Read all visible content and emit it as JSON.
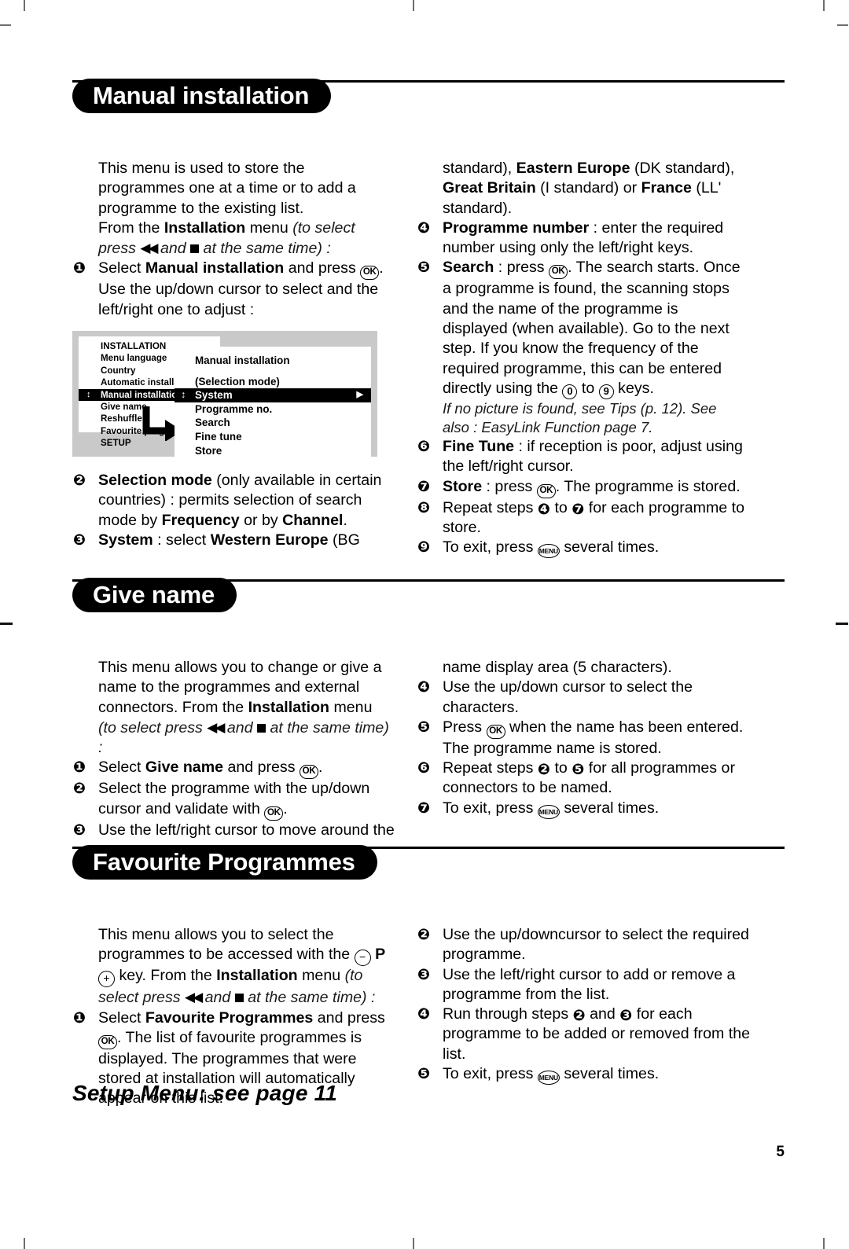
{
  "document": {
    "page_number": "5",
    "setup_note": "Setup Menu: see page 11"
  },
  "sections": [
    {
      "id": "manual-installation",
      "heading": "Manual installation",
      "left": {
        "intro": "This menu is used to store the programmes one at a time or to add a programme to the existing list.",
        "from_menu_prefix": "From the ",
        "from_menu_bold": "Installation",
        "from_menu_mid": " menu ",
        "from_menu_italic_a": "(to select press ",
        "from_menu_italic_b": " and ",
        "from_menu_italic_c": " at the same time) :",
        "step1_a": "Select ",
        "step1_bold": "Manual installation",
        "step1_b": " and press ",
        "step1_c": ". Use the up/down cursor to select and the left/right one to adjust :",
        "step2_bold": "Selection mode",
        "step2_a": " (only available in certain countries) : permits selection of search mode by ",
        "step2_bold2": "Frequency",
        "step2_b": " or by ",
        "step2_bold3": "Channel",
        "step2_c": ".",
        "step3_bold": "System",
        "step3_a": " : select ",
        "step3_bold2": "Western Europe",
        "step3_b": " (BG"
      },
      "figure": {
        "left_menu": {
          "title": "INSTALLATION",
          "items": [
            "Menu language",
            "Country",
            "Automatic installat",
            "Manual installation",
            "Give name",
            "Reshuffle",
            "Favourite program",
            "SETUP"
          ],
          "selected_index": 3
        },
        "right_menu": {
          "title": "Manual installation",
          "items": [
            "(Selection mode)",
            "System",
            "Programme no.",
            "Search",
            "Fine tune",
            "Store"
          ],
          "selected_index": 1
        }
      },
      "right": {
        "cont_a": "standard), ",
        "cont_bold1": "Eastern Europe",
        "cont_b": " (DK standard), ",
        "cont_bold2": "Great Britain",
        "cont_c": " (I standard) or ",
        "cont_bold3": "France",
        "cont_d": " (LL' standard).",
        "step4_bold": "Programme number",
        "step4_a": " : enter the required number using only the left/right keys.",
        "step5_bold": "Search",
        "step5_a": " : press ",
        "step5_b": ". The search starts. Once a programme is found, the scanning stops and the name of the programme is displayed (when available). Go to the next step. If you know the frequency of the required programme, this can be entered directly using the ",
        "step5_c": " to ",
        "step5_d": " keys.",
        "step5_note": "If no picture is found, see Tips (p. 12). See also : EasyLink Function page 7.",
        "step6_bold": "Fine Tune",
        "step6_a": " : if reception is poor, adjust using the left/right cursor.",
        "step7_bold": "Store",
        "step7_a": " : press ",
        "step7_b": ". The programme is stored.",
        "step8_a": "Repeat steps ",
        "step8_b": " to ",
        "step8_c": " for each programme to store.",
        "step9_a": "To exit, press ",
        "step9_b": " several times."
      }
    },
    {
      "id": "give-name",
      "heading": "Give name",
      "left": {
        "intro_a": "This menu allows you to change or give a name to the programmes and external connectors. From the ",
        "intro_bold": "Installation",
        "intro_b": " menu",
        "intro_italic_a": "(to select press ",
        "intro_italic_b": " and ",
        "intro_italic_c": " at the same time) :",
        "step1_a": "Select ",
        "step1_bold": "Give name",
        "step1_b": " and press ",
        "step1_c": ".",
        "step2_a": "Select the programme with the up/down cursor and validate with ",
        "step2_b": ".",
        "step3_a": "Use the left/right cursor to move around the"
      },
      "right": {
        "cont": "name display area (5 characters).",
        "step4": "Use the up/down cursor to select the characters.",
        "step5_a": "Press ",
        "step5_b": " when the name has been entered. The programme name is stored.",
        "step6_a": "Repeat steps ",
        "step6_b": " to ",
        "step6_c": " for all programmes or connectors to be named.",
        "step7_a": "To exit, press ",
        "step7_b": " several times."
      }
    },
    {
      "id": "favourite-programmes",
      "heading": "Favourite Programmes",
      "left": {
        "intro_a": "This menu allows you to select the programmes to be accessed with the ",
        "intro_p": "P",
        "intro_b": " key. From the ",
        "intro_bold": "Installation",
        "intro_c": " menu ",
        "intro_italic_a": "(to select press ",
        "intro_italic_b": " and ",
        "intro_italic_c": " at the same time) :",
        "step1_a": "Select ",
        "step1_bold": "Favourite Programmes",
        "step1_b": " and press ",
        "step1_c": ". The list of favourite programmes is displayed. The programmes that were stored at installation will automatically appear on this list."
      },
      "right": {
        "step2": "Use the up/downcursor to select the required programme.",
        "step3": "Use the left/right cursor to add or remove a programme from the list.",
        "step4_a": "Run through steps ",
        "step4_b": " and ",
        "step4_c": " for each programme to be added or removed from the list.",
        "step5_a": "To exit, press ",
        "step5_b": " several times."
      }
    }
  ],
  "glyphs": {
    "ok": "OK",
    "menu": "MENU",
    "zero": "0",
    "nine": "9",
    "minus": "−",
    "plus": "+",
    "rewind": "◀◀",
    "stop": "■",
    "updown": "↕",
    "right_arrow": "▶",
    "b1": "❶",
    "b2": "❷",
    "b3": "❸",
    "b4": "❹",
    "b5": "❺",
    "b6": "❻",
    "b7": "❼",
    "b8": "❽",
    "b9": "❾"
  }
}
